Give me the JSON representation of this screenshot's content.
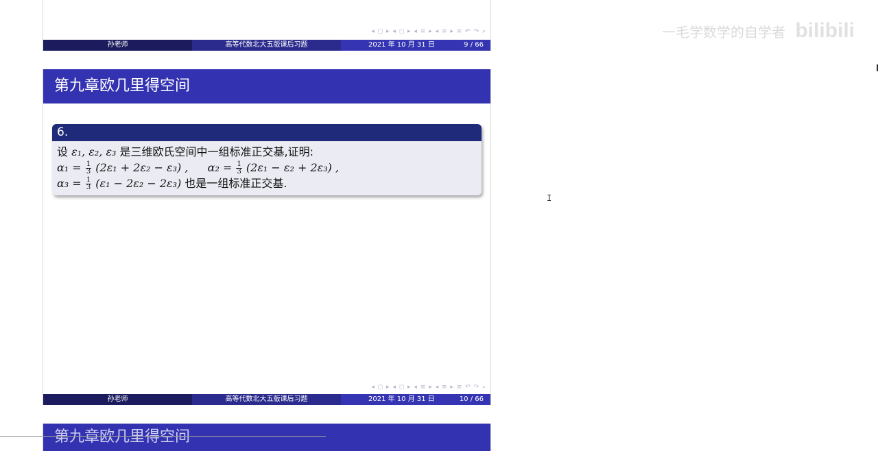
{
  "viewer": {
    "watermark_text": "一毛学数学的自学者",
    "watermark_logo": "bilibili"
  },
  "footer": {
    "author": "孙老师",
    "course": "高等代数北大五版课后习题",
    "date": "2021 年 10 月 31 日"
  },
  "nav_symbols": "◂ ◻ ▸ ◂ ◻ ▸ ◂ ≡ ▸ ◂ ≡ ▸   ≡   ↶ ↷ ⌕",
  "slides": [
    {
      "page": "9 / 66"
    },
    {
      "page": "10 / 66",
      "title": "第九章欧几里得空间",
      "block_title": "6.",
      "line1_prefix": "设",
      "line1_math": "ε₁, ε₂, ε₃",
      "line1_suffix": "是三维欧氏空间中一组标准正交基,证明:",
      "alpha1_lhs": "α₁ =",
      "alpha1_rhs": "(2ε₁ + 2ε₂ − ε₃) ,",
      "alpha2_lhs": "α₂ =",
      "alpha2_rhs": "(2ε₁ − ε₂ + 2ε₃) ,",
      "alpha3_lhs": "α₃ =",
      "alpha3_rhs": "(ε₁ − 2ε₂ − 2ε₃)",
      "line3_suffix": "也是一组标准正交基.",
      "frac_num": "1",
      "frac_den": "3"
    },
    {
      "title": "第九章欧几里得空间"
    }
  ]
}
